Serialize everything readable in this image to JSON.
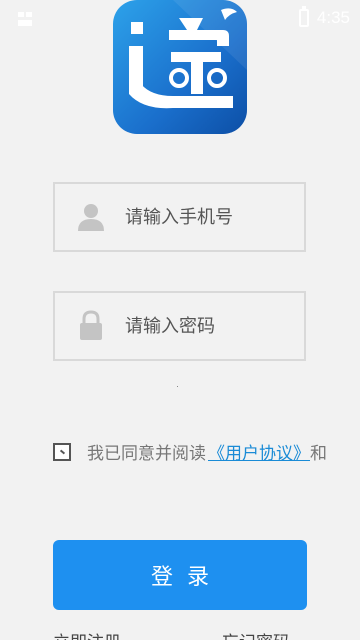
{
  "status_bar": {
    "time": "4:35"
  },
  "logo": {
    "icon": "app-logo-icon",
    "colors": {
      "start": "#2da2ea",
      "end": "#0d4fa6"
    }
  },
  "form": {
    "phone_placeholder": "请输入手机号",
    "password_placeholder": "请输入密码"
  },
  "agreement": {
    "text": "我已同意并阅读",
    "link_label": "《用户协议》",
    "tail": "和"
  },
  "login_label": "登录",
  "bottom": {
    "register_label": "立即注册",
    "forgot_label": "忘记密码"
  },
  "colors": {
    "accent": "#1e90f0",
    "link": "#1a8bd6",
    "background": "#f2f2f2"
  }
}
